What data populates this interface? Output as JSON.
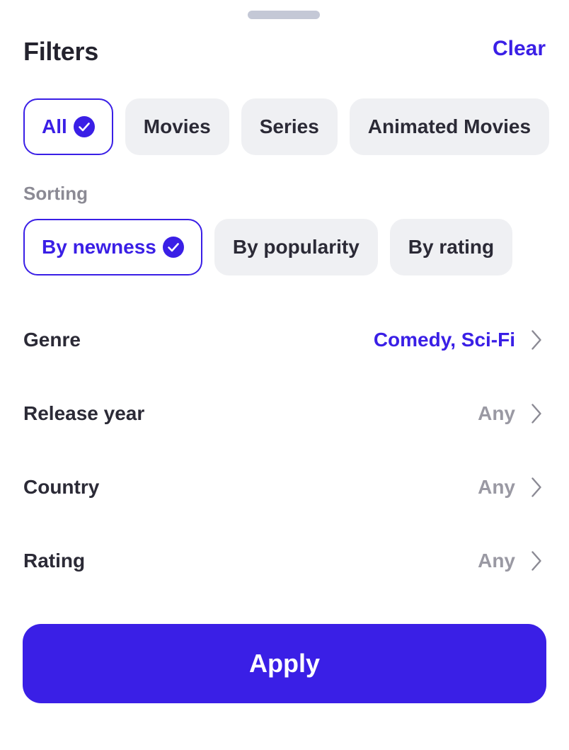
{
  "header": {
    "title": "Filters",
    "clear_label": "Clear"
  },
  "content_types": [
    {
      "label": "All",
      "selected": true
    },
    {
      "label": "Movies",
      "selected": false
    },
    {
      "label": "Series",
      "selected": false
    },
    {
      "label": "Animated Movies",
      "selected": false
    }
  ],
  "sorting": {
    "label": "Sorting",
    "options": [
      {
        "label": "By newness",
        "selected": true
      },
      {
        "label": "By popularity",
        "selected": false
      },
      {
        "label": "By rating",
        "selected": false
      }
    ]
  },
  "filters": [
    {
      "label": "Genre",
      "value": "Comedy, Sci-Fi",
      "has_selection": true
    },
    {
      "label": "Release year",
      "value": "Any",
      "has_selection": false
    },
    {
      "label": "Country",
      "value": "Any",
      "has_selection": false
    },
    {
      "label": "Rating",
      "value": "Any",
      "has_selection": false
    }
  ],
  "apply_label": "Apply",
  "colors": {
    "accent": "#3a1fe6",
    "chip_bg": "#eff0f3",
    "text": "#2b2a36",
    "muted": "#9a99a3",
    "handle": "#c4c8d6"
  },
  "icons": {
    "check": "check-circle-icon",
    "chevron": "chevron-right-icon"
  }
}
